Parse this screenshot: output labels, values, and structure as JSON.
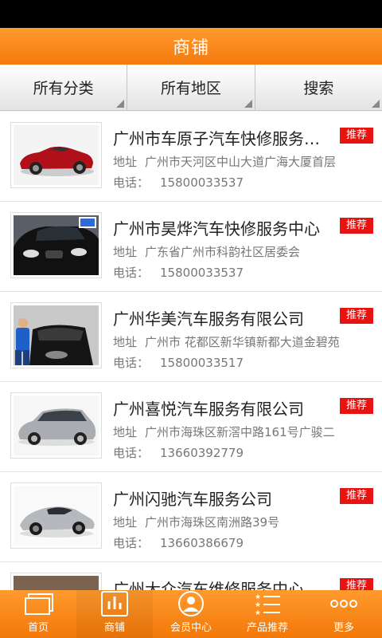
{
  "header": {
    "title": "商铺"
  },
  "filters": [
    {
      "label": "所有分类"
    },
    {
      "label": "所有地区"
    },
    {
      "label": "搜索"
    }
  ],
  "labels": {
    "address": "地址",
    "phone": "电话：",
    "badge": "推荐"
  },
  "shops": [
    {
      "name": "广州市车原子汽车快修服务中心",
      "address": "广州市天河区中山大道广海大厦首层",
      "phone": "15800033537",
      "image": "red-convertible"
    },
    {
      "name": "广州市昊烨汽车快修服务中心",
      "address": "广东省广州市科韵社区居委会",
      "phone": "15800033537",
      "image": "black-bmw"
    },
    {
      "name": "广州华美汽车服务有限公司",
      "address": "广州市 花都区新华镇新都大道金碧苑",
      "phone": "15800033517",
      "image": "car-wash"
    },
    {
      "name": "广州喜悦汽车服务有限公司",
      "address": "广州市海珠区新滘中路161号广骏二",
      "phone": "13660392779",
      "image": "silver-wagon"
    },
    {
      "name": "广州闪驰汽车服务公司",
      "address": "广州市海珠区南洲路39号",
      "phone": "13660386679",
      "image": "silver-supercar"
    },
    {
      "name": "广州大众汽车维修服务中心",
      "address": "",
      "phone": "",
      "image": "dark-car"
    }
  ],
  "bottom_nav": [
    {
      "label": "首页",
      "icon": "home-icon"
    },
    {
      "label": "商铺",
      "icon": "chart-icon"
    },
    {
      "label": "会员中心",
      "icon": "user-icon"
    },
    {
      "label": "产品推荐",
      "icon": "star-list-icon"
    },
    {
      "label": "更多",
      "icon": "more-icon"
    }
  ],
  "colors": {
    "accent": "#f47a0c",
    "badge": "#e8130f"
  }
}
